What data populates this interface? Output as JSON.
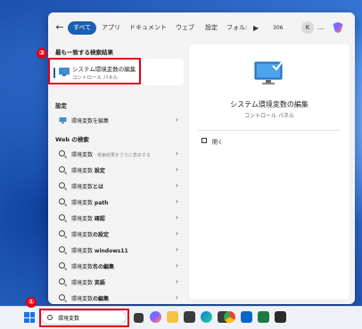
{
  "search_panel": {
    "tabs": {
      "all": "すべて",
      "apps": "アプリ",
      "documents": "ドキュメント",
      "web": "ウェブ",
      "settings": "設定",
      "folders": "フォル:",
      "play": "▶",
      "count": "306",
      "avatar": "K",
      "more": "…"
    },
    "best_match": {
      "heading": "最も一致する検索結果",
      "title": "システム環境変数の編集",
      "subtitle": "コントロール パネル"
    },
    "settings_section": {
      "heading": "設定",
      "item": "環境変数を編集"
    },
    "web_section": {
      "heading": "Web の検索",
      "items": [
        {
          "label": "環境変数",
          "hint": " - 検索結果をさらに表示する"
        },
        {
          "label": "環境変数 ",
          "bold": "設定"
        },
        {
          "label": "環境変数",
          "bold": "とは"
        },
        {
          "label": "環境変数 ",
          "bold": "path"
        },
        {
          "label": "環境変数 ",
          "bold": "確認"
        },
        {
          "label": "環境変数",
          "bold": "の設定"
        },
        {
          "label": "環境変数 ",
          "bold": "windows11"
        },
        {
          "label": "環境変数",
          "bold": "名の編集"
        },
        {
          "label": "環境変数 ",
          "bold": "英語"
        },
        {
          "label": "環境変数",
          "bold": "の編集"
        }
      ]
    },
    "preview": {
      "title": "システム環境変数の編集",
      "subtitle": "コントロール パネル",
      "open_label": "開く"
    }
  },
  "annotations": {
    "marker_1": "①",
    "marker_2": "②"
  },
  "taskbar": {
    "search_value": "環境変数",
    "app_icons": [
      "task-view-icon",
      "copilot-icon",
      "file-explorer-icon",
      "edge-icon",
      "terminal-icon",
      "chrome-icon",
      "mail-icon",
      "excel-icon",
      "terminal-icon"
    ]
  },
  "colors": {
    "accent": "#1a5fb4",
    "highlight": "#e00018"
  }
}
